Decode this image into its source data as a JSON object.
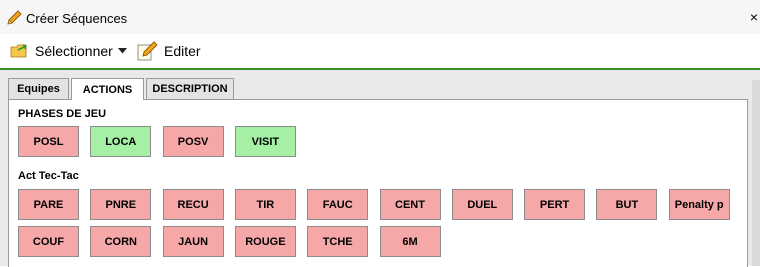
{
  "window": {
    "title": "Créer Séquences",
    "close_glyph": "×"
  },
  "toolbar": {
    "select_label": "Sélectionner",
    "edit_label": "Editer"
  },
  "tabs": [
    {
      "label": "Equipes",
      "active": false
    },
    {
      "label": "ACTIONS",
      "active": true
    },
    {
      "label": "DESCRIPTION",
      "active": false
    }
  ],
  "sections": {
    "phases": {
      "label": "PHASES DE JEU",
      "buttons": [
        {
          "label": "POSL",
          "color": "red"
        },
        {
          "label": "LOCA",
          "color": "green"
        },
        {
          "label": "POSV",
          "color": "red"
        },
        {
          "label": "VISIT",
          "color": "green"
        }
      ]
    },
    "act": {
      "label": "Act Tec-Tac",
      "buttons": [
        {
          "label": "PARE",
          "color": "red"
        },
        {
          "label": "PNRE",
          "color": "red"
        },
        {
          "label": "RECU",
          "color": "red"
        },
        {
          "label": "TIR",
          "color": "red"
        },
        {
          "label": "FAUC",
          "color": "red"
        },
        {
          "label": "CENT",
          "color": "red"
        },
        {
          "label": "DUEL",
          "color": "red"
        },
        {
          "label": "PERT",
          "color": "red"
        },
        {
          "label": "BUT",
          "color": "red"
        },
        {
          "label": "Penalty p",
          "color": "red"
        },
        {
          "label": "COUF",
          "color": "red"
        },
        {
          "label": "CORN",
          "color": "red"
        },
        {
          "label": "JAUN",
          "color": "red"
        },
        {
          "label": "ROUGE",
          "color": "red"
        },
        {
          "label": "TCHE",
          "color": "red"
        },
        {
          "label": "6M",
          "color": "red"
        }
      ]
    }
  },
  "colors": {
    "red_button": "#f6a8a8",
    "green_button": "#a6f0a6",
    "toolbar_accent": "#3a8f2a"
  },
  "icons": {
    "title": "pencil-icon",
    "select": "folder-arrow-icon",
    "dropdown": "caret-down-icon",
    "edit": "edit-pencil-icon",
    "close": "close-icon"
  }
}
